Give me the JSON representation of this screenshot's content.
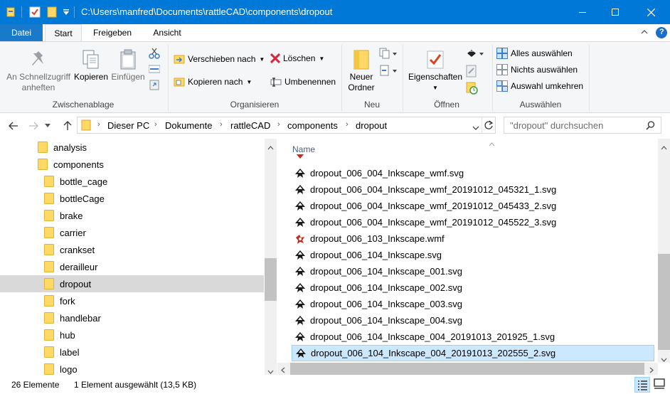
{
  "window": {
    "title": "C:\\Users\\manfred\\Documents\\rattleCAD\\components\\dropout",
    "minimize": "—",
    "maximize": "☐",
    "close": "✕"
  },
  "tabs": [
    {
      "label": "Datei"
    },
    {
      "label": "Start"
    },
    {
      "label": "Freigeben"
    },
    {
      "label": "Ansicht"
    }
  ],
  "ribbon": {
    "clipboard": {
      "pin_label_1": "An Schnellzugriff",
      "pin_label_2": "anheften",
      "copy_label": "Kopieren",
      "paste_label": "Einfügen",
      "group_label": "Zwischenablage"
    },
    "organize": {
      "move_label": "Verschieben nach",
      "copy_to_label": "Kopieren nach",
      "delete_label": "Löschen",
      "rename_label": "Umbenennen",
      "group_label": "Organisieren"
    },
    "new": {
      "new_folder_1": "Neuer",
      "new_folder_2": "Ordner",
      "group_label": "Neu"
    },
    "open": {
      "properties_label": "Eigenschaften",
      "group_label": "Öffnen"
    },
    "select": {
      "select_all": "Alles auswählen",
      "select_none": "Nichts auswählen",
      "invert": "Auswahl umkehren",
      "group_label": "Auswählen"
    }
  },
  "address": {
    "crumbs": [
      "Dieser PC",
      "Dokumente",
      "rattleCAD",
      "components",
      "dropout"
    ],
    "search_placeholder": "\"dropout\" durchsuchen"
  },
  "nav": {
    "items": [
      {
        "label": "analysis",
        "level": 0
      },
      {
        "label": "components",
        "level": 0
      },
      {
        "label": "bottle_cage",
        "level": 1
      },
      {
        "label": "bottleCage",
        "level": 1
      },
      {
        "label": "brake",
        "level": 1
      },
      {
        "label": "carrier",
        "level": 1
      },
      {
        "label": "crankset",
        "level": 1
      },
      {
        "label": "derailleur",
        "level": 1
      },
      {
        "label": "dropout",
        "level": 1,
        "selected": true
      },
      {
        "label": "fork",
        "level": 1
      },
      {
        "label": "handlebar",
        "level": 1
      },
      {
        "label": "hub",
        "level": 1
      },
      {
        "label": "label",
        "level": 1
      },
      {
        "label": "logo",
        "level": 1
      }
    ]
  },
  "files": {
    "column_name": "Name",
    "rows": [
      {
        "name": "dropout_006_004_Inkscape_wmf.svg",
        "type": "svg"
      },
      {
        "name": "dropout_006_004_Inkscape_wmf_20191012_045321_1.svg",
        "type": "svg"
      },
      {
        "name": "dropout_006_004_Inkscape_wmf_20191012_045433_2.svg",
        "type": "svg"
      },
      {
        "name": "dropout_006_004_Inkscape_wmf_20191012_045522_3.svg",
        "type": "svg"
      },
      {
        "name": "dropout_006_103_Inkscape.wmf",
        "type": "wmf"
      },
      {
        "name": "dropout_006_104_Inkscape.svg",
        "type": "svg"
      },
      {
        "name": "dropout_006_104_Inkscape_001.svg",
        "type": "svg"
      },
      {
        "name": "dropout_006_104_Inkscape_002.svg",
        "type": "svg"
      },
      {
        "name": "dropout_006_104_Inkscape_003.svg",
        "type": "svg"
      },
      {
        "name": "dropout_006_104_Inkscape_004.svg",
        "type": "svg"
      },
      {
        "name": "dropout_006_104_Inkscape_004_20191013_201925_1.svg",
        "type": "svg"
      },
      {
        "name": "dropout_006_104_Inkscape_004_20191013_202555_2.svg",
        "type": "svg",
        "selected": true
      }
    ]
  },
  "status": {
    "count": "26 Elemente",
    "selection": "1 Element ausgewählt (13,5 KB)"
  },
  "colors": {
    "titlebar": "#0078d7",
    "selection": "#cce8ff",
    "folder": "#ffd866"
  }
}
